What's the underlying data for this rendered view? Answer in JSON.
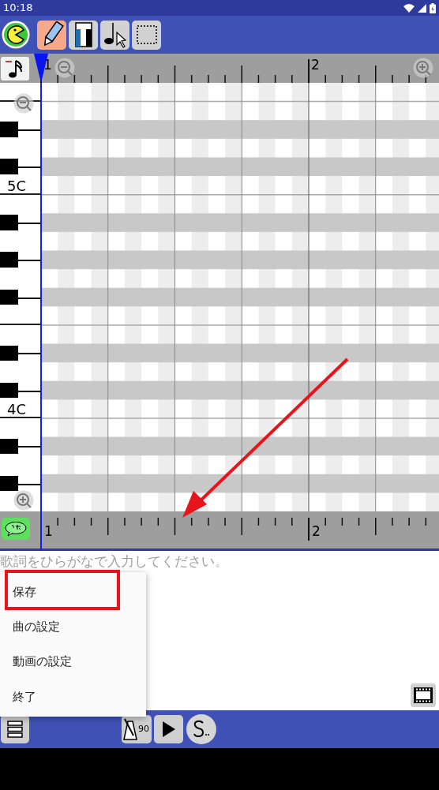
{
  "status_bar": {
    "time": "10:18"
  },
  "toolbar": {
    "tools": [
      {
        "kind": "pencil",
        "selected": true
      },
      {
        "kind": "eraser",
        "selected": false
      },
      {
        "kind": "pointer",
        "selected": false
      },
      {
        "kind": "select",
        "selected": false
      }
    ]
  },
  "ruler": {
    "measures": [
      "1",
      "2"
    ]
  },
  "piano": {
    "keys": [
      {
        "kind": "white"
      },
      {
        "kind": "white"
      },
      {
        "kind": "black"
      },
      {
        "kind": "white"
      },
      {
        "kind": "black"
      },
      {
        "kind": "white",
        "label": "5C"
      },
      {
        "kind": "white"
      },
      {
        "kind": "black"
      },
      {
        "kind": "white"
      },
      {
        "kind": "black"
      },
      {
        "kind": "white"
      },
      {
        "kind": "black"
      },
      {
        "kind": "white"
      },
      {
        "kind": "white"
      },
      {
        "kind": "black"
      },
      {
        "kind": "white"
      },
      {
        "kind": "black"
      },
      {
        "kind": "white",
        "label": "4C"
      },
      {
        "kind": "white"
      },
      {
        "kind": "black"
      },
      {
        "kind": "white"
      },
      {
        "kind": "black"
      },
      {
        "kind": "white"
      }
    ]
  },
  "bottom_ruler": {
    "measures": [
      "1",
      "2"
    ]
  },
  "lyrics": {
    "placeholder": "歌詞をひらがなで入力してください。"
  },
  "menu": {
    "items": [
      "保存",
      "曲の設定",
      "動画の設定",
      "終了"
    ]
  },
  "transport": {
    "tempo": "90"
  }
}
